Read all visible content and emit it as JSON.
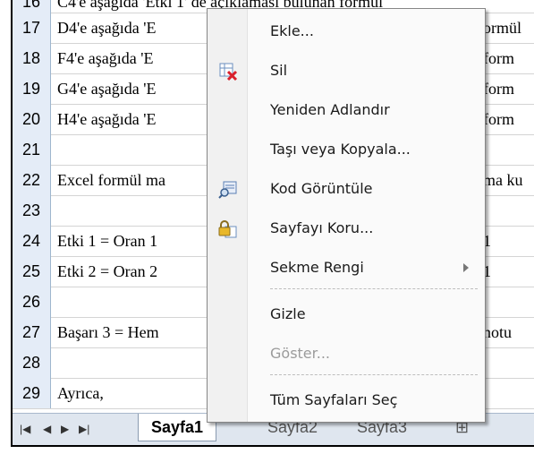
{
  "grid": {
    "top_partial": "C4'e aşağıda 'Etki 1' de açıklaması bulunan formül",
    "rows": [
      {
        "num": "17",
        "left": "D4'e aşağıda 'E",
        "right": "ormül"
      },
      {
        "num": "18",
        "left": "F4'e aşağıda 'E",
        "right": "form"
      },
      {
        "num": "19",
        "left": "G4'e aşağıda 'E",
        "right": "form"
      },
      {
        "num": "20",
        "left": "H4'e aşağıda 'E",
        "right": "form"
      },
      {
        "num": "21",
        "left": "",
        "right": ""
      },
      {
        "num": "22",
        "left": "Excel formül ma",
        "right": "ma ku"
      },
      {
        "num": "23",
        "left": "",
        "right": ""
      },
      {
        "num": "24",
        "left": "Etki 1 = Oran 1",
        "right": "1"
      },
      {
        "num": "25",
        "left": "Etki 2 = Oran 2",
        "right": "1"
      },
      {
        "num": "26",
        "left": "",
        "right": ""
      },
      {
        "num": "27",
        "left": "Başarı 3 = Hem",
        "right": "notu"
      },
      {
        "num": "28",
        "left": "",
        "right": ""
      },
      {
        "num": "29",
        "left": "Ayrıca,",
        "right": ""
      }
    ]
  },
  "sheet_tabs": {
    "active": "Sayfa1",
    "others": [
      "Sayfa2",
      "Sayfa3"
    ]
  },
  "context_menu": {
    "items": [
      {
        "label": "Ekle...",
        "icon": "none",
        "disabled": false
      },
      {
        "label": "Sil",
        "icon": "delete-sheet-icon",
        "disabled": false
      },
      {
        "label": "Yeniden Adlandır",
        "icon": "none",
        "disabled": false
      },
      {
        "label": "Taşı veya Kopyala...",
        "icon": "none",
        "disabled": false
      },
      {
        "label": "Kod Görüntüle",
        "icon": "view-code-icon",
        "disabled": false
      },
      {
        "label": "Sayfayı Koru...",
        "icon": "protect-sheet-icon",
        "disabled": false
      },
      {
        "label": "Sekme Rengi",
        "icon": "none",
        "disabled": false,
        "submenu": true
      },
      {
        "label": "Gizle",
        "icon": "none",
        "disabled": false
      },
      {
        "label": "Göster...",
        "icon": "none",
        "disabled": true
      },
      {
        "label": "Tüm Sayfaları Seç",
        "icon": "none",
        "disabled": false
      }
    ]
  }
}
